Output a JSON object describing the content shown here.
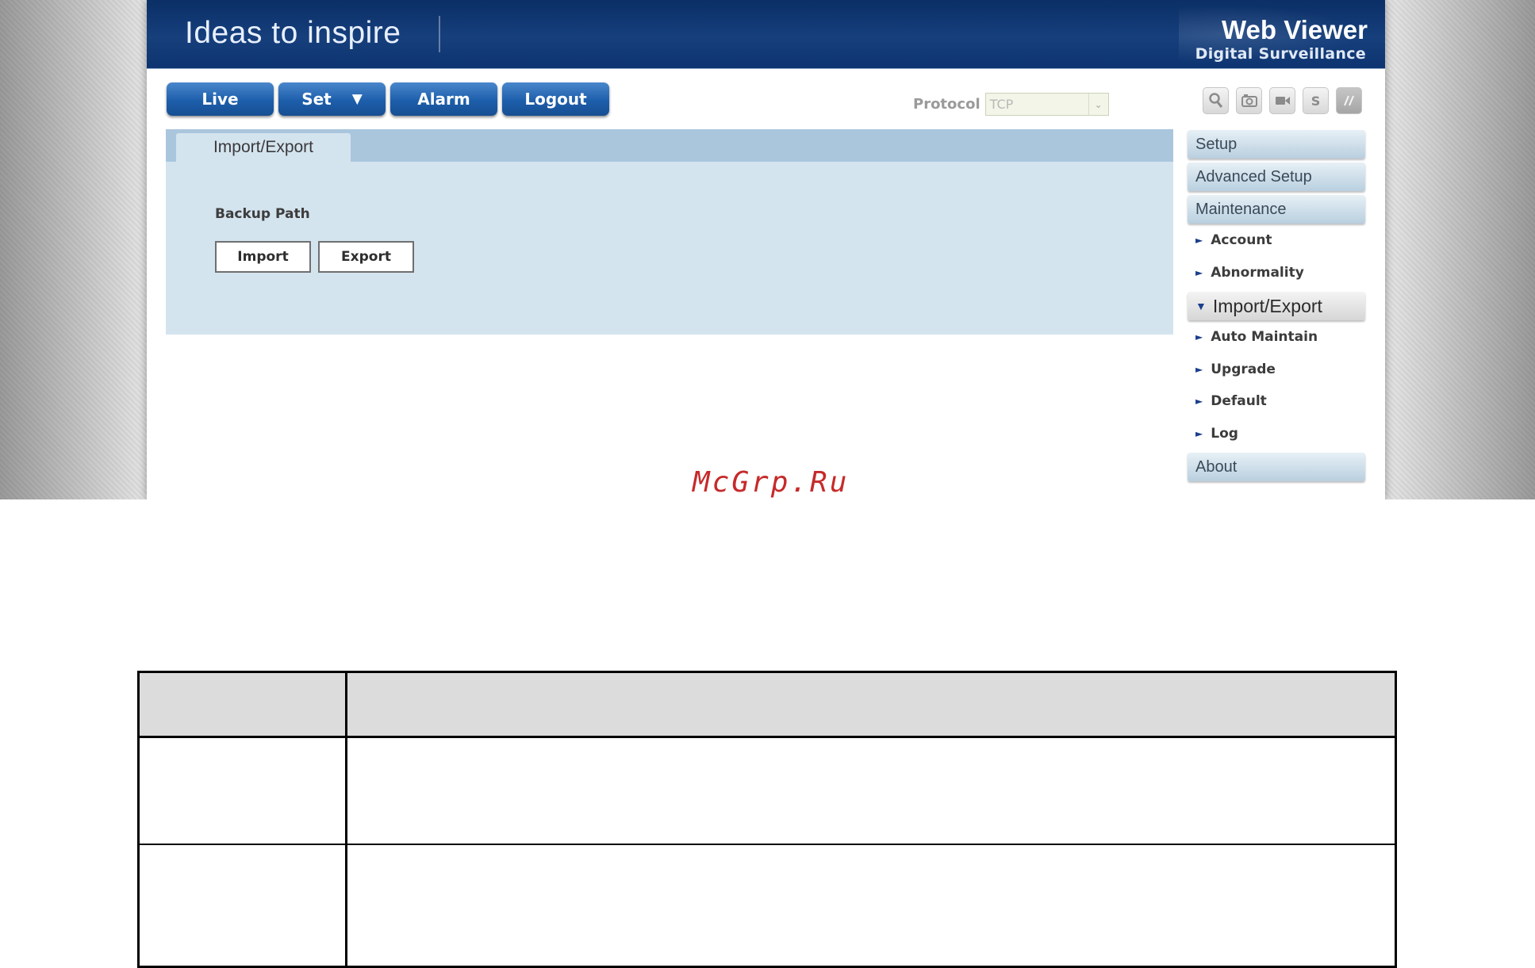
{
  "banner": {
    "slogan": "Ideas to inspire",
    "title": "Web Viewer",
    "subtitle": "Digital Surveillance"
  },
  "nav": {
    "live": "Live",
    "set": "Set",
    "set_caret": "▼",
    "alarm": "Alarm",
    "logout": "Logout"
  },
  "protocol": {
    "label": "Protocol",
    "value": "TCP",
    "arrow": "⌄"
  },
  "toolbar": {
    "icons": [
      "search-icon",
      "snapshot-icon",
      "record-icon",
      "s-icon",
      "fullscreen-icon"
    ],
    "s_label": "S"
  },
  "panel": {
    "tab": "Import/Export",
    "backup_label": "Backup Path",
    "import": "Import",
    "export": "Export"
  },
  "side_menu": {
    "setup": "Setup",
    "advanced_setup": "Advanced Setup",
    "maintenance": "Maintenance",
    "account": "Account",
    "abnormality": "Abnormality",
    "import_export": "Import/Export",
    "auto_maintain": "Auto Maintain",
    "upgrade": "Upgrade",
    "default": "Default",
    "log": "Log",
    "about": "About",
    "collapsed_marker": "►",
    "expanded_marker": "▼"
  },
  "watermark": "McGrp.Ru",
  "colors": {
    "banner": "#163f7c",
    "nav_button": "#1d5eab",
    "panel": "#d4e4ef",
    "tab_bar": "#a9c6dd",
    "menu_arrow": "#1a3f8d",
    "watermark": "#c62a2a"
  }
}
